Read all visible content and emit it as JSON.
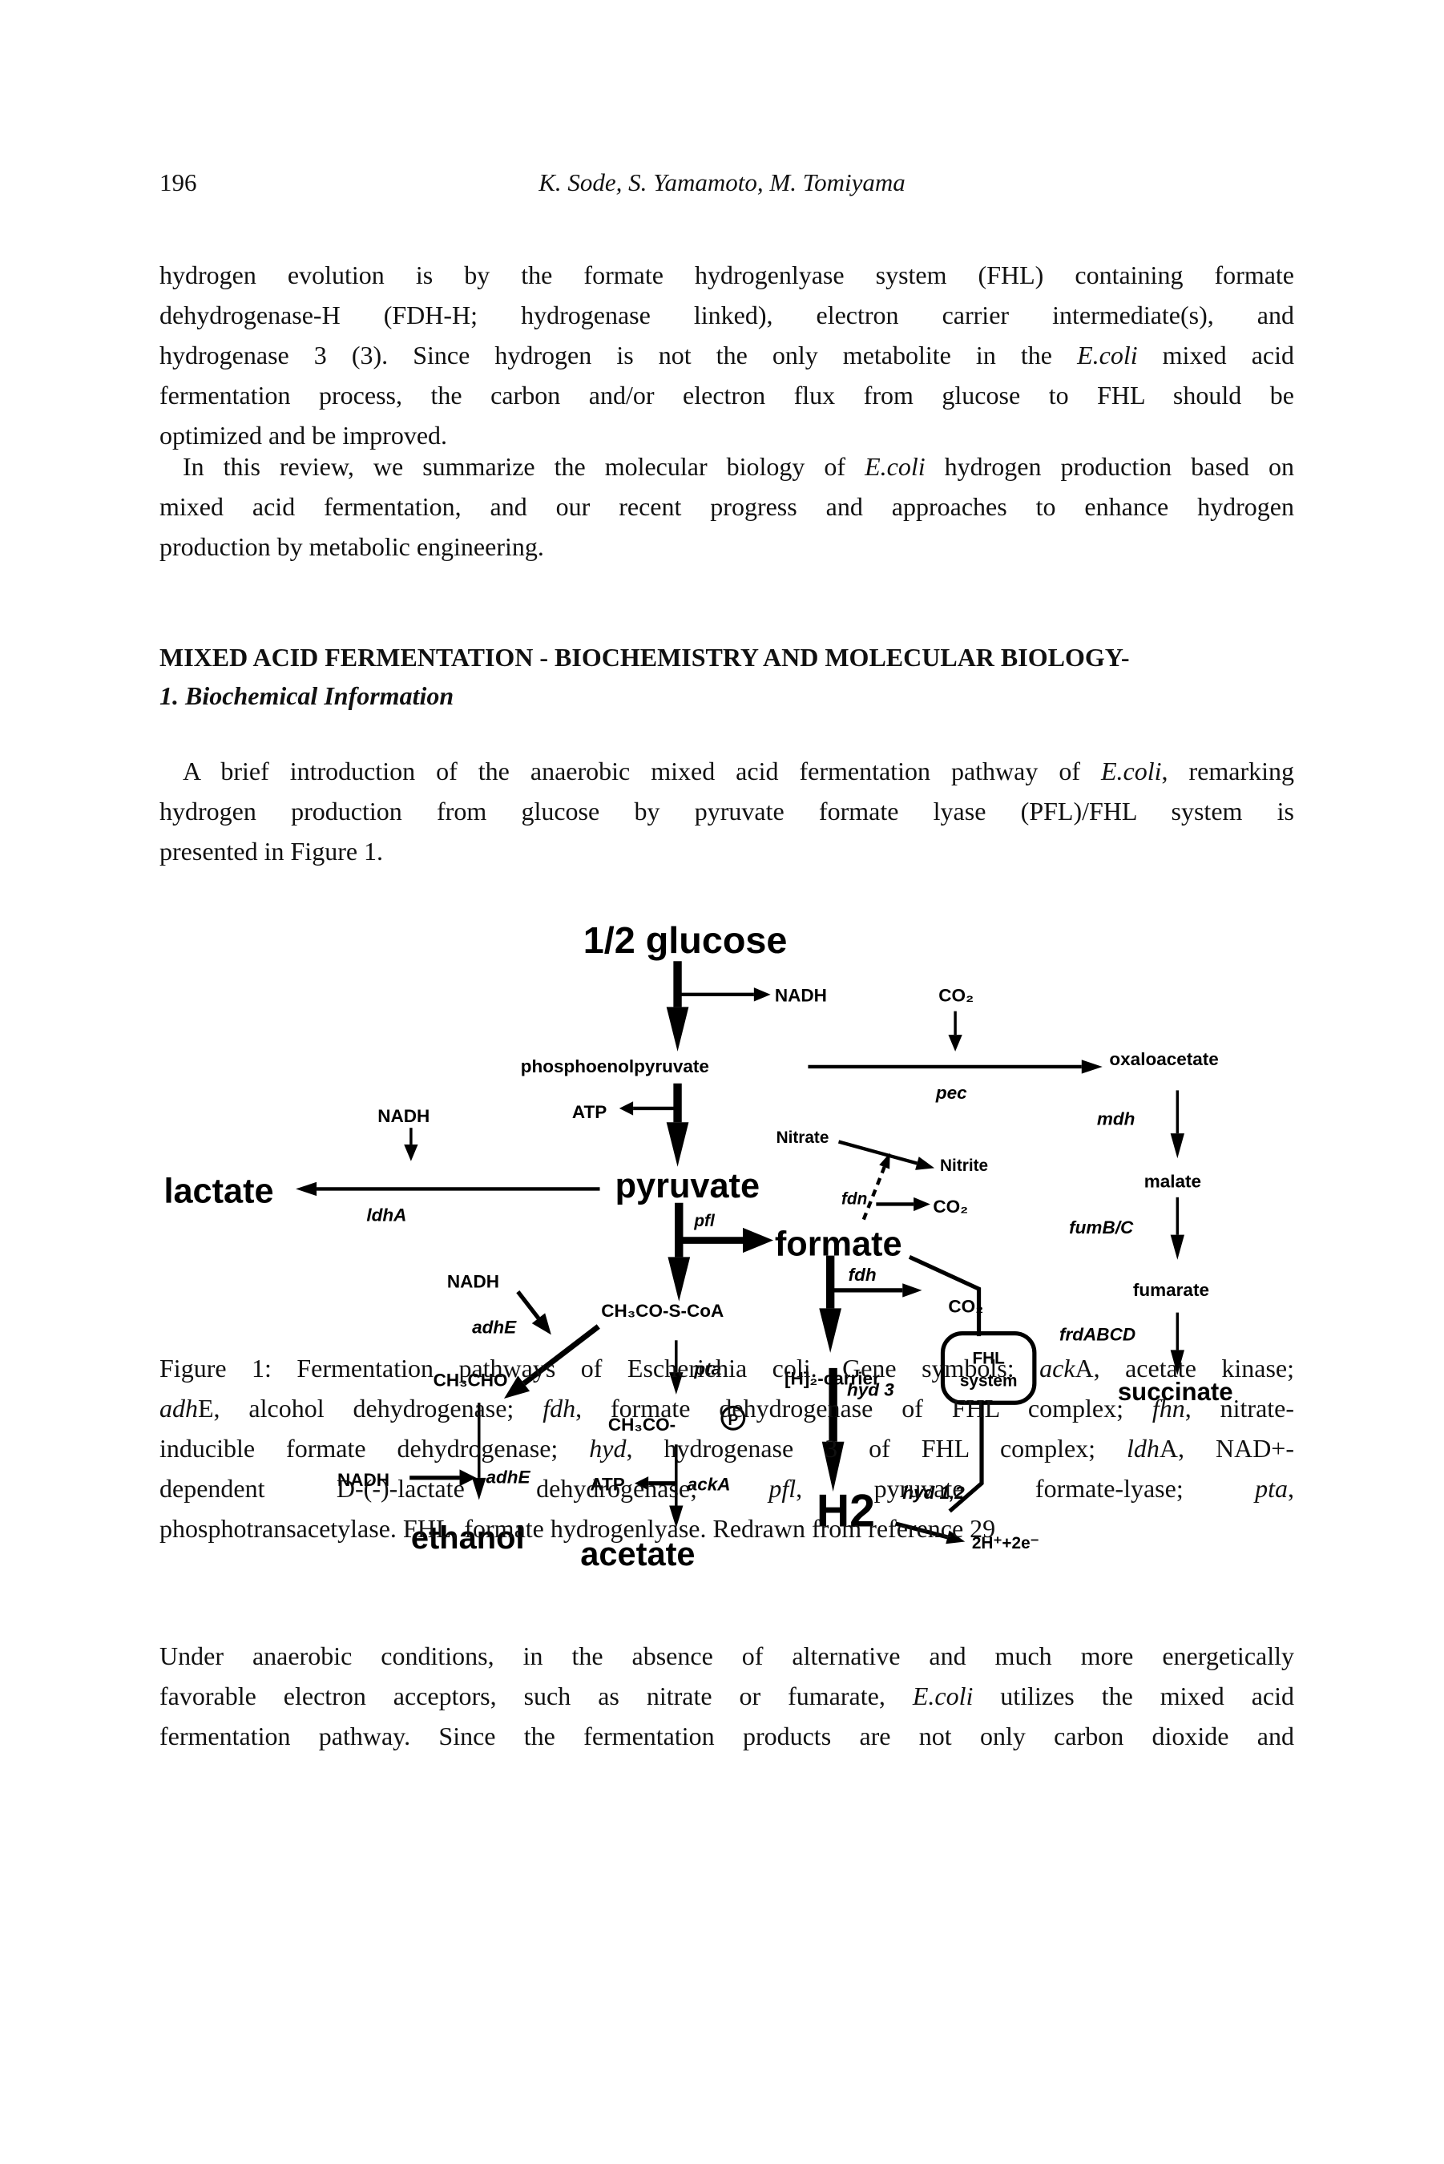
{
  "header": {
    "page_number": "196",
    "authors": "K. Sode, S. Yamamoto, M. Tomiyama"
  },
  "para1": [
    [
      "hydrogen evolution is by the formate hydrogenlyase system (FHL) containing formate"
    ],
    [
      "dehydrogenase-H (FDH-H; hydrogenase linked), electron carrier intermediate(s), and"
    ],
    [
      "hydrogenase 3 (3).  Since hydrogen is not the only metabolite in the ",
      {
        "i": "E.coli"
      },
      " mixed acid"
    ],
    [
      "fermentation process, the carbon and/or electron flux from glucose to FHL should be"
    ],
    [
      "optimized and be improved."
    ]
  ],
  "para2": [
    [
      "In this review, we summarize the molecular biology of ",
      {
        "i": "E.coli"
      },
      " hydrogen production based on"
    ],
    [
      "mixed acid fermentation, and our recent progress and approaches to enhance hydrogen"
    ],
    [
      "production by metabolic engineering."
    ]
  ],
  "section": {
    "heading": "MIXED ACID FERMENTATION  - BIOCHEMISTRY AND MOLECULAR BIOLOGY-",
    "subheading": "1. Biochemical Information"
  },
  "para3": [
    [
      "A brief introduction of the anaerobic mixed acid fermentation pathway of ",
      {
        "i": "E.coli"
      },
      ", remarking"
    ],
    [
      "hydrogen production from glucose by pyruvate formate lyase (PFL)/FHL system is"
    ],
    [
      "presented in Figure 1."
    ]
  ],
  "diagram": {
    "glucose": "1/2 glucose",
    "nadh_top": "NADH",
    "co2_top": "CO₂",
    "pep": "phosphoenolpyruvate",
    "oxaloacetate": "oxaloacetate",
    "pec": "pec",
    "atp_top": "ATP",
    "nadh_ldh": "NADH",
    "lactate": "lactate",
    "ldhA": "ldhA",
    "pyruvate": "pyruvate",
    "nitrate": "Nitrate",
    "nitrite": "Nitrite",
    "fdn": "fdn",
    "co2_fdn": "CO₂",
    "mdh": "mdh",
    "malate": "malate",
    "fumBC": "fumB/C",
    "fumarate": "fumarate",
    "frdABCD": "frdABCD",
    "succinate": "succinate",
    "pfl": "pfl",
    "formate": "formate",
    "fdh": "fdh",
    "co2_fdh": "CO₂",
    "fhl_line1": "FHL",
    "fhl_line2": "system",
    "h2_carrier": "[H]₂-carrier",
    "hyd3": "hyd 3",
    "h2": "H2",
    "hyd12": "hyd 1,2",
    "protons": "2H⁺+2e⁻",
    "nadh_adh": "NADH",
    "acetyl_coa": "CH₃CO-S-CoA",
    "adhE_1": "adhE",
    "acetaldehyde": "CH₃CHO",
    "pta": "pta",
    "acetyl_p": "CH₃CO-",
    "phosphate": "P",
    "nadh_adh2": "NADH",
    "adhE_2": "adhE",
    "atp_ack": "ATP",
    "ackA": "ackA",
    "ethanol": "ethanol",
    "acetate": "acetate"
  },
  "caption": [
    [
      "Figure 1:  Fermentation pathways of Escherichia coli.  Gene symbols: ",
      {
        "i": "ack"
      },
      "A, acetate kinase;"
    ],
    [
      {
        "i": "adh"
      },
      "E, alcohol dehydrogenase; ",
      {
        "i": "fdh"
      },
      ", formate dehydrogenase of FHL complex; ",
      {
        "i": "fhn"
      },
      ", nitrate-"
    ],
    [
      "inducible formate dehydrogenase; ",
      {
        "i": "hyd"
      },
      ", hydrogenase 3 of FHL complex; ",
      {
        "i": "ldh"
      },
      "A, NAD+-"
    ],
    [
      "dependent  D-(-)-lactate  dehydrogenase;  ",
      {
        "i": "pfl"
      },
      ",  pyruvate  formate-lyase;  ",
      {
        "i": "pta"
      },
      ","
    ],
    [
      "phosphotransacetylase.  FHL, formate hydrogenlyase.  Redrawn from reference 29"
    ]
  ],
  "para4": [
    [
      "Under anaerobic conditions, in the absence of alternative and much more energetically"
    ],
    [
      "favorable  electron acceptors, such as nitrate or fumarate, ",
      {
        "i": "E.coli"
      },
      " utilizes the mixed acid"
    ],
    [
      "fermentation pathway.  Since the fermentation products are not only carbon dioxide and"
    ]
  ]
}
